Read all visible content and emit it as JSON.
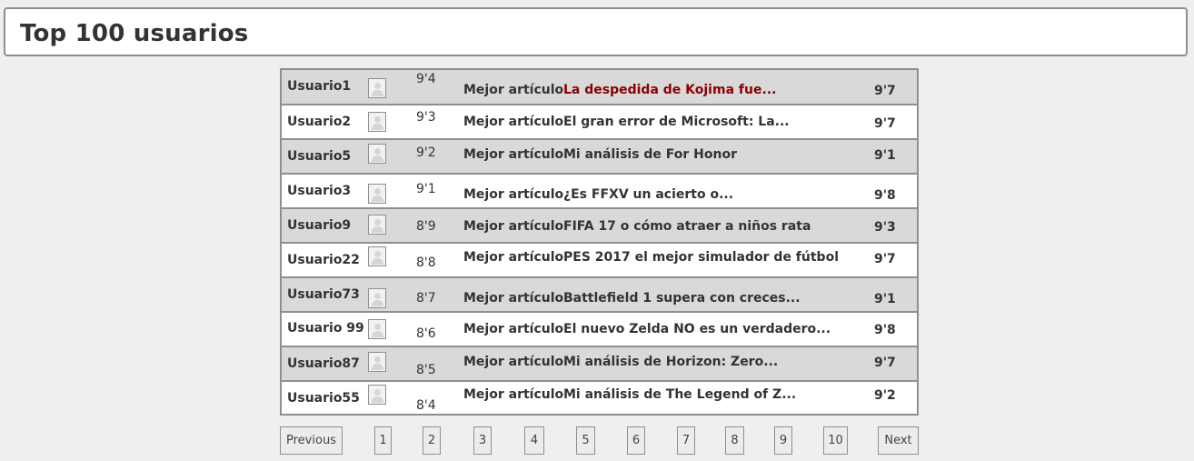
{
  "header": {
    "title": "Top 100 usuarios"
  },
  "rows": [
    {
      "user": "Usuario1",
      "score": "9'4",
      "best": "Mejor artículo",
      "title": "La despedida de Kojima fue...",
      "rating": "9'7",
      "highlight": true
    },
    {
      "user": "Usuario2",
      "score": "9'3",
      "best": "Mejor artículo",
      "title": "El gran error de Microsoft: La...",
      "rating": "9'7"
    },
    {
      "user": "Usuario5",
      "score": "9'2",
      "best": "Mejor artículo",
      "title": "Mi análisis de For Honor",
      "rating": "9'1"
    },
    {
      "user": "Usuario3",
      "score": "9'1",
      "best": "Mejor artículo",
      "title": "¿Es FFXV un acierto o...",
      "rating": "9'8"
    },
    {
      "user": "Usuario9",
      "score": "8'9",
      "best": "Mejor artículo",
      "title": "FIFA 17 o cómo atraer a niños rata",
      "rating": "9'3"
    },
    {
      "user": "Usuario22",
      "score": "8'8",
      "best": "Mejor artículo",
      "title": "PES 2017 el mejor simulador de fútbol",
      "rating": "9'7"
    },
    {
      "user": "Usuario73",
      "score": "8'7",
      "best": "Mejor artículo",
      "title": "Battlefield 1 supera con creces...",
      "rating": "9'1"
    },
    {
      "user": "Usuario 99",
      "score": "8'6",
      "best": "Mejor artículo",
      "title": "El nuevo Zelda NO es un verdadero...",
      "rating": "9'8"
    },
    {
      "user": "Usuario87",
      "score": "8'5",
      "best": "Mejor artículo",
      "title": "Mi análisis de Horizon: Zero...",
      "rating": "9'7"
    },
    {
      "user": "Usuario55",
      "score": "8'4",
      "best": "Mejor artículo",
      "title": " Mi análisis de The Legend of Z...",
      "rating": "9'2"
    }
  ],
  "pager": {
    "previous": "Previous",
    "next": "Next",
    "pages": [
      "1",
      "2",
      "3",
      "4",
      "5",
      "6",
      "7",
      "8",
      "9",
      "10"
    ]
  },
  "colors": {
    "highlight": "#8b0000",
    "row_alt": "#d9d9d9",
    "border": "#8f8f8f"
  }
}
